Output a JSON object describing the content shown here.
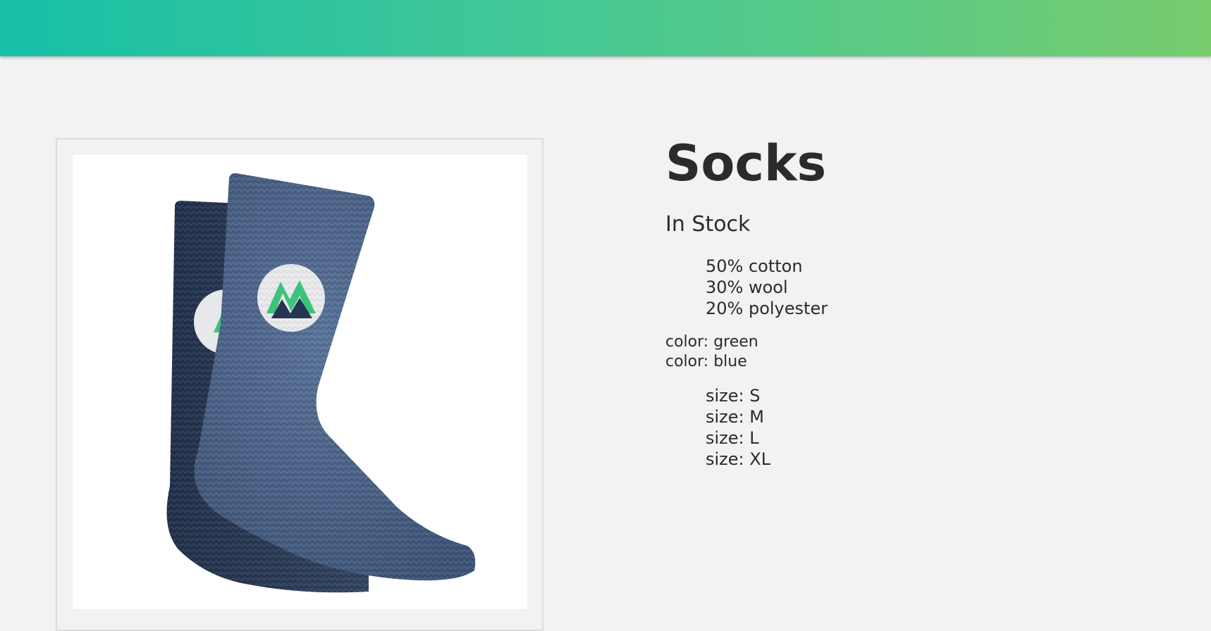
{
  "product": {
    "name": "Socks",
    "stock_status": "In Stock",
    "materials": [
      "50% cotton",
      "30% wool",
      "20% polyester"
    ],
    "colors": [
      "color: green",
      "color: blue"
    ],
    "sizes": [
      "size: S",
      "size: M",
      "size: L",
      "size: XL"
    ],
    "image_icon": "socks-product-image"
  },
  "theme": {
    "header_gradient_start": "#17bfa7",
    "header_gradient_end": "#78cc6e",
    "sock_front": "#4a6287",
    "sock_back": "#2d3d55",
    "logo_green": "#3cc37a",
    "logo_navy": "#253553",
    "background": "#f2f2f2"
  }
}
